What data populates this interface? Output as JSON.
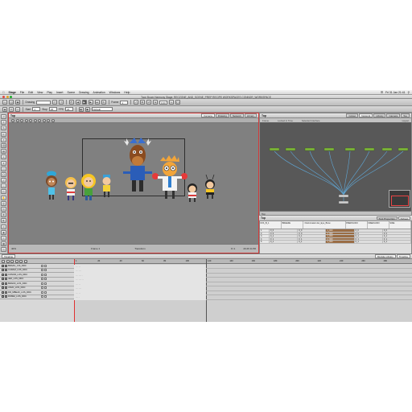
{
  "mac_menubar": {
    "apple": "",
    "app_name": "Stage",
    "menus": [
      "File",
      "Edit",
      "View",
      "Play",
      "Insert",
      "Scene",
      "Drawing",
      "Animation",
      "Windows",
      "Help"
    ],
    "clock": "Fri 31 Jan 21:41"
  },
  "window": {
    "title": "Toon Boom Harmony Stage: RECZONE_AND_SCENE_PREP RECIPE WORKSPACES CONNOR_WORKSPACE"
  },
  "toolbar1": {
    "drawing_label": "Drawing",
    "frame_label": "Frame",
    "frame_value": "1",
    "zoom_value": "0.00"
  },
  "toolbar2": {
    "start_label": "Start",
    "start_value": "1",
    "stop_label": "Stop",
    "stop_value": "25",
    "fps_label": "FPS",
    "fps_value": "24",
    "default_label": "Default"
  },
  "camera_view": {
    "title": "Top",
    "tabs": [
      "Camera",
      "Drawing",
      "Network",
      "Library"
    ],
    "active_tab": "Camera",
    "zoom": "40%",
    "status_mode": "Frame 1",
    "status_tool": "Transform",
    "status_coords": "20.26 11.56",
    "status_frame": "Fr 1"
  },
  "node_view": {
    "title": "Top",
    "tabs": [
      "Colour",
      "Network",
      "Library",
      "Camera",
      "Too"
    ],
    "active_tab": "Network",
    "subbar": [
      "Frame",
      "Locked in Time",
      "Selected Interface",
      "Layout"
    ],
    "bottom_label": "Top"
  },
  "xsheet_panel": {
    "tabs": [
      "Tool Properties",
      "Xsheet"
    ],
    "active_tab": "Xsheet",
    "headers": [
      "FFS_B_1",
      "BREEZE",
      "r Deformation Ex_Eye_Brow",
      "PREDSUDO",
      "FREESUDO",
      "SIDE"
    ],
    "rows": [
      [
        "0_0",
        "0_0",
        "1_000",
        "0_0",
        "0_0"
      ],
      [
        "0_0",
        "0_0",
        "1_000",
        "0_0",
        "0_0"
      ],
      [
        "0_1",
        "0_1",
        "1_000",
        "0_1",
        "0_1"
      ],
      [
        "0_1",
        "0_1",
        "1_000",
        "0_1",
        "0_1"
      ],
      [
        "0_1",
        "0_1",
        "1_000",
        "0_1",
        "0_1"
      ]
    ],
    "current_label": "Current: 1 : Deformation-Switch_Kinematic_Clone_Attached_Reference_W",
    "zoom_label": "Zoo"
  },
  "timeline": {
    "tab": "Timeline",
    "right_tabs": [
      "Module Library",
      "Timeline"
    ],
    "ruler": [
      "1",
      "20",
      "40",
      "60",
      "80",
      "100",
      "120",
      "140",
      "160",
      "180",
      "200",
      "220",
      "240",
      "260",
      "280"
    ],
    "layers": [
      {
        "name": "BRAZIL_CIS_DDC",
        "keys": "·····"
      },
      {
        "name": "CARAM_LOS_DDC",
        "keys": "······"
      },
      {
        "name": "CONOR_LOS_DDC",
        "keys": "·······"
      },
      {
        "name": "JED_LOS_DDC",
        "keys": "········"
      },
      {
        "name": "BRANN_LOS_DDC",
        "keys": "·····"
      },
      {
        "name": "JOHN_LOS_DDC",
        "keys": "······"
      },
      {
        "name": "DR_MBEAK_LOS_DDC",
        "keys": "·····"
      },
      {
        "name": "ROMEI_LOS_DDC",
        "keys": "····"
      }
    ]
  },
  "colors": {
    "view_border": "#d23a3a",
    "stage_bg": "#808080",
    "node_bg": "#585858",
    "node_wire": "#5fa8d8",
    "playhead": "#e03030",
    "selected_row": "#9a6d45"
  },
  "characters": [
    "Brazil",
    "Caram",
    "Conor",
    "Jed",
    "Brann",
    "Moose",
    "Dr Mbeak",
    "Romei",
    "Bee"
  ]
}
